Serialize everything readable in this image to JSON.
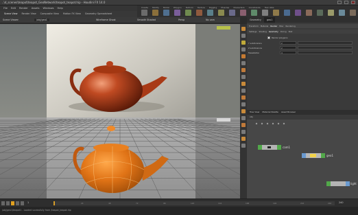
{
  "window": {
    "title": "..\\d_scenes\\teapot\\teapot_GeoNetwork\\teapot_teapot.hip - Houdini FX 14.0"
  },
  "menu": {
    "items": [
      "File",
      "Edit",
      "Render",
      "Assets",
      "Windows",
      "Help"
    ]
  },
  "desktop_tabs": [
    "Scene View",
    "Render View",
    "Composite View",
    "Motion FX View",
    "Geometry Spreadsheet"
  ],
  "shelf": {
    "tabs": [
      "Create",
      "Modify",
      "Model",
      "Polygon",
      "Deform",
      "Texture",
      "Rigging",
      "Muscles",
      "Characters",
      "Constraints",
      "Hair Utils"
    ]
  },
  "viewport": {
    "path_label": "/obj/geo1",
    "title": "Scene Viewer",
    "display_option": "Wireframe Ghost",
    "render_mode": "Smooth Shaded",
    "camera_label": "Persp",
    "view_mode": "No cam"
  },
  "params": {
    "tabs": [
      "Geometry",
      "geo1"
    ],
    "section_tabs": [
      "Transform",
      "Material",
      "Render",
      "Misc",
      "Rendering"
    ],
    "subsection_tabs": [
      "Settings",
      "Shading",
      "Geometry",
      "Dicing",
      "Stat"
    ],
    "checkbox_label": "Render polygons",
    "rows": [
      {
        "label": "Y subdivisions",
        "value": "2"
      },
      {
        "label": "Z subdivisions",
        "value": "2"
      },
      {
        "label": "Tessellation",
        "value": "4"
      }
    ]
  },
  "network": {
    "tabs": [
      "Tree View",
      "Material Palette",
      "Asset Browser"
    ],
    "path": "obj",
    "nodes": [
      {
        "name": "cam1",
        "color": "#52a84a"
      },
      {
        "name": "geo1",
        "color": "#b8b8b8"
      },
      {
        "name": "light",
        "color": "#52a84a"
      }
    ]
  },
  "timeline": {
    "start_frame": "1",
    "end_frame": "240",
    "ticks": [
      "1",
      "24",
      "48",
      "72",
      "96",
      "120",
      "144",
      "168",
      "192",
      "216",
      "240"
    ]
  },
  "status": {
    "text": "/obj/geo1/teapot1 - Loaded sucessfully from /teapot_teapot.hip"
  },
  "colors": {
    "teapot_top": "#b5411c",
    "teapot_bottom": "#e07316",
    "node_selected": "#f2d34a"
  }
}
